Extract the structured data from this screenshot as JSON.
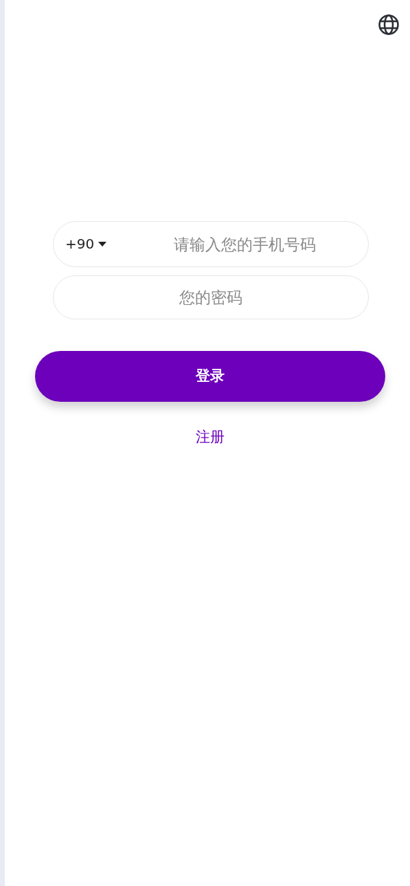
{
  "header": {
    "language_button": true
  },
  "login_form": {
    "country_code": "+90",
    "phone": {
      "placeholder": "请输入您的手机号码"
    },
    "password": {
      "placeholder": "您的密码"
    },
    "submit": "登录",
    "register_link": "注册"
  }
}
